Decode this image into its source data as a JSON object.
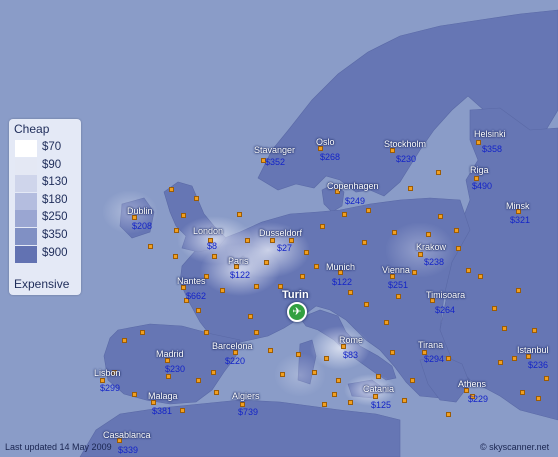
{
  "legend": {
    "cheap_label": "Cheap",
    "expensive_label": "Expensive",
    "bands": [
      {
        "price": "$70",
        "color": "#ffffff"
      },
      {
        "price": "$90",
        "color": "#e4e8f4"
      },
      {
        "price": "$130",
        "color": "#cfd5eb"
      },
      {
        "price": "$180",
        "color": "#b4bddf"
      },
      {
        "price": "$250",
        "color": "#9aa6d2"
      },
      {
        "price": "$350",
        "color": "#8090c4"
      },
      {
        "price": "$900",
        "color": "#6272b2"
      }
    ]
  },
  "origin": {
    "name": "Turin",
    "icon": "plane-icon"
  },
  "cities": [
    {
      "name": "Stavanger",
      "price": "$352"
    },
    {
      "name": "Oslo",
      "price": "$268"
    },
    {
      "name": "Stockholm",
      "price": "$230"
    },
    {
      "name": "Helsinki",
      "price": "$358"
    },
    {
      "name": "Riga",
      "price": "$490"
    },
    {
      "name": "Copenhagen",
      "price": "$249"
    },
    {
      "name": "Minsk",
      "price": "$321"
    },
    {
      "name": "Dublin",
      "price": "$208"
    },
    {
      "name": "London",
      "price": "$8"
    },
    {
      "name": "Dusseldorf",
      "price": "$27"
    },
    {
      "name": "Krakow",
      "price": "$238"
    },
    {
      "name": "Paris",
      "price": "$122"
    },
    {
      "name": "Munich",
      "price": "$122"
    },
    {
      "name": "Vienna",
      "price": "$251"
    },
    {
      "name": "Nantes",
      "price": "$662"
    },
    {
      "name": "Timisoara",
      "price": "$264"
    },
    {
      "name": "Barcelona",
      "price": "$220"
    },
    {
      "name": "Rome",
      "price": "$83"
    },
    {
      "name": "Tirana",
      "price": "$294"
    },
    {
      "name": "Istanbul",
      "price": "$236"
    },
    {
      "name": "Madrid",
      "price": "$230"
    },
    {
      "name": "Lisbon",
      "price": "$299"
    },
    {
      "name": "Malaga",
      "price": "$381"
    },
    {
      "name": "Algiers",
      "price": "$739"
    },
    {
      "name": "Catania",
      "price": "$125"
    },
    {
      "name": "Athens",
      "price": "$229"
    },
    {
      "name": "Casablanca",
      "price": "$339"
    }
  ],
  "footer": {
    "updated": "Last updated 14 May 2009",
    "credit": "© skyscanner.net"
  },
  "colors": {
    "sea": "#8a9cc8",
    "land": "#6676b4",
    "city_label": "#ffffff",
    "price_label": "#1424c8",
    "airport_dot": "#f2a020",
    "origin_marker": "#32a040"
  }
}
